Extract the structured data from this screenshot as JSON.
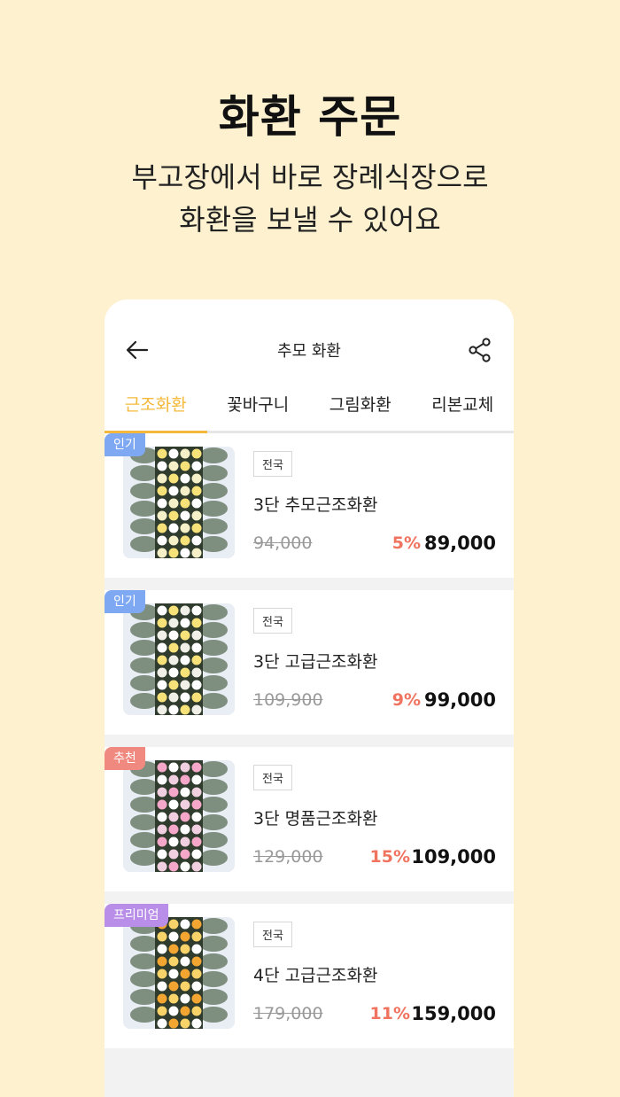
{
  "hero": {
    "title": "화환 주문",
    "subtitle_line1": "부고장에서 바로 장례식장으로",
    "subtitle_line2": "화환을 보낼 수 있어요"
  },
  "appbar": {
    "title": "추모 화환",
    "back_icon": "arrow-left-icon",
    "share_icon": "share-icon"
  },
  "tabs": [
    {
      "label": "근조화환",
      "active": true
    },
    {
      "label": "꽃바구니",
      "active": false
    },
    {
      "label": "그림화환",
      "active": false
    },
    {
      "label": "리본교체",
      "active": false
    }
  ],
  "colors": {
    "background": "#fdf1cf",
    "accent": "#f4b93a",
    "discount": "#f0735f",
    "badge_popular": "#7ea8f2",
    "badge_recommend": "#f08a80",
    "badge_premium": "#b98ee8"
  },
  "products": [
    {
      "badge": "인기",
      "badge_type": "popular",
      "region": "전국",
      "name": "3단 추모근조화환",
      "original_price": "94,000",
      "discount": "5%",
      "price": "89,000"
    },
    {
      "badge": "인기",
      "badge_type": "popular",
      "region": "전국",
      "name": "3단 고급근조화환",
      "original_price": "109,900",
      "discount": "9%",
      "price": "99,000"
    },
    {
      "badge": "추천",
      "badge_type": "recommend",
      "region": "전국",
      "name": "3단 명품근조화환",
      "original_price": "129,000",
      "discount": "15%",
      "price": "109,000"
    },
    {
      "badge": "프리미엄",
      "badge_type": "premium",
      "region": "전국",
      "name": "4단 고급근조화환",
      "original_price": "179,000",
      "discount": "11%",
      "price": "159,000"
    }
  ]
}
